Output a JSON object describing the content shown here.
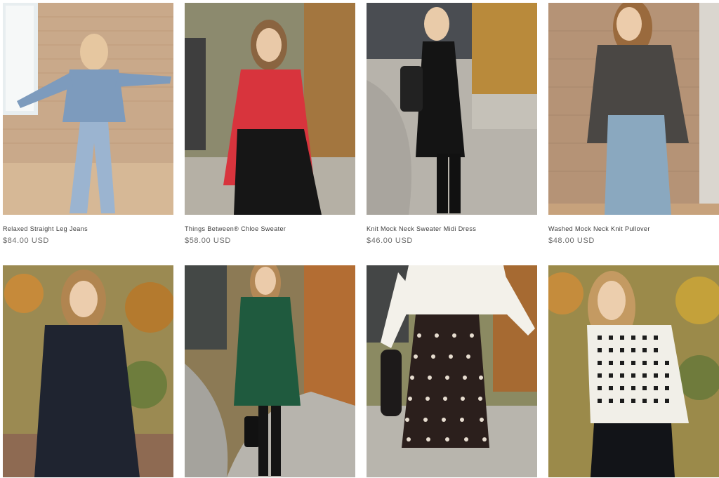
{
  "products": [
    {
      "title": "Relaxed Straight Leg Jeans",
      "price": "$84.00 USD"
    },
    {
      "title": "Things Between® Chloe Sweater",
      "price": "$58.00 USD"
    },
    {
      "title": "Knit Mock Neck Sweater Midi Dress",
      "price": "$46.00 USD"
    },
    {
      "title": "Washed Mock Neck Knit Pullover",
      "price": "$48.00 USD"
    },
    {
      "title": "",
      "price": ""
    },
    {
      "title": "",
      "price": ""
    },
    {
      "title": "",
      "price": ""
    },
    {
      "title": "",
      "price": ""
    }
  ],
  "colors": {
    "title_text": "#3a3a3a",
    "price_text": "#6b6b6b",
    "background": "#ffffff"
  }
}
